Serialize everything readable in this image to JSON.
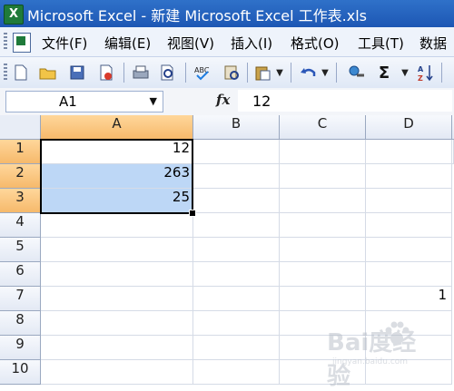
{
  "window": {
    "app_icon": "excel-app-icon",
    "title": "Microsoft Excel - 新建 Microsoft Excel 工作表.xls"
  },
  "menu": {
    "items": [
      "文件(F)",
      "编辑(E)",
      "视图(V)",
      "插入(I)",
      "格式(O)",
      "工具(T)",
      "数据"
    ]
  },
  "toolbar": {
    "icons": [
      "new-icon",
      "open-icon",
      "save-icon",
      "permission-icon",
      "print-icon",
      "print-preview-icon",
      "spelling-icon",
      "research-icon",
      "paste-icon",
      "undo-icon",
      "hyperlink-icon",
      "autosum-icon",
      "sort-ascending-icon"
    ],
    "autosum_glyph": "Σ"
  },
  "formula_bar": {
    "name_box": "A1",
    "fx_label": "fx",
    "value": "12"
  },
  "grid": {
    "columns": [
      "A",
      "B",
      "C",
      "D"
    ],
    "rows": [
      "1",
      "2",
      "3",
      "4",
      "5",
      "6",
      "7",
      "8",
      "9",
      "10"
    ],
    "cells": {
      "A1": "12",
      "A2": "263",
      "A3": "25",
      "E7": "1"
    },
    "selected_range": "A1:A3",
    "active_cell": "A1"
  },
  "watermark": {
    "main": "Bai度经验",
    "sub": "jingyan.baidu.com"
  },
  "colors": {
    "titlebar": "#1d57b4",
    "selection_fill": "#bdd7f6",
    "header_selected": "#f6b96b"
  }
}
